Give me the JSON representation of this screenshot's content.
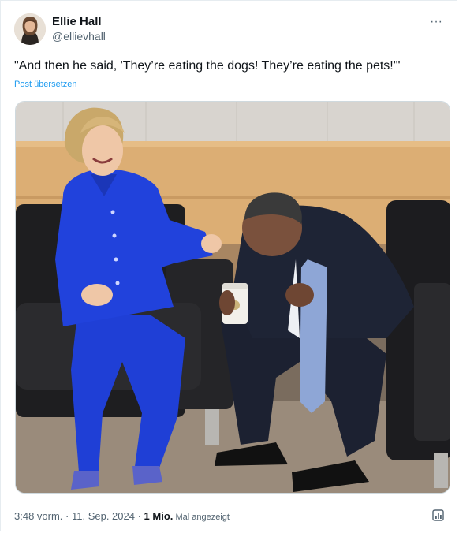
{
  "author": {
    "display_name": "Ellie Hall",
    "handle": "@ellievhall"
  },
  "tweet": {
    "text": "\"And then he said, 'They’re eating the dogs! They’re eating the pets!'\"",
    "translate_label": "Post übersetzen"
  },
  "meta": {
    "time": "3:48 vorm.",
    "separator1": " · ",
    "date": "11. Sep. 2024",
    "separator2": " · ",
    "views_count": "1 Mio.",
    "views_label": " Mal angezeigt"
  },
  "more_menu_glyph": "···",
  "colors": {
    "link": "#1d9bf0",
    "muted": "#536471",
    "suit_blue": "#1f3fd6",
    "suit_dark": "#1b2130"
  },
  "icons": [
    "more-options-icon",
    "analytics-icon"
  ]
}
